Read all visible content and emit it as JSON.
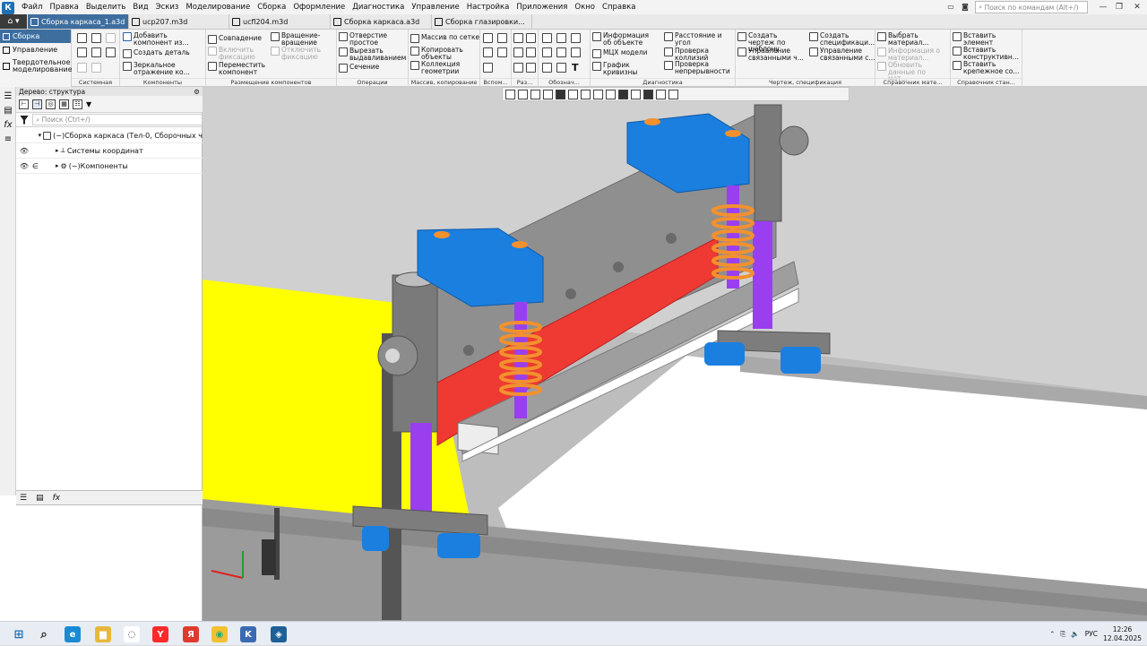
{
  "app": {
    "logo_text": "К"
  },
  "menu": [
    "Файл",
    "Правка",
    "Выделить",
    "Вид",
    "Эскиз",
    "Моделирование",
    "Сборка",
    "Оформление",
    "Диагностика",
    "Управление",
    "Настройка",
    "Приложения",
    "Окно",
    "Справка"
  ],
  "search": {
    "placeholder": "Поиск по командам (Alt+/)"
  },
  "window_controls": {
    "minimize": "—",
    "restore": "❐",
    "close": "✕"
  },
  "tabs": [
    {
      "label": "Сборка каркаса_1.a3d",
      "active": true
    },
    {
      "label": "ucp207.m3d",
      "active": false
    },
    {
      "label": "ucfl204.m3d",
      "active": false
    },
    {
      "label": "Сборка каркаса.a3d",
      "active": false
    },
    {
      "label": "Сборка глазировки...",
      "active": false
    }
  ],
  "leftnav": [
    {
      "label": "Сборка",
      "active": true
    },
    {
      "label": "Управление",
      "active": false
    },
    {
      "label": "Твердотельное моделирование",
      "active": false
    }
  ],
  "ribbon": {
    "groups": [
      {
        "label": "Системная"
      },
      {
        "label": "Компоненты"
      },
      {
        "label": "Размещение компонентов"
      },
      {
        "label": "Операции"
      },
      {
        "label": "Массив, копирование"
      },
      {
        "label": "Вспом..."
      },
      {
        "label": "Раз..."
      },
      {
        "label": "Обознач..."
      },
      {
        "label": "Диагностика"
      },
      {
        "label": "Чертеж, спецификация"
      },
      {
        "label": "Справочник мате..."
      },
      {
        "label": "Справочник стан..."
      }
    ],
    "components": {
      "add": "Добавить компонент из...",
      "create_part": "Создать деталь",
      "mirror": "Зеркальное отражение ко..."
    },
    "placement": {
      "coincidence": "Совпадение",
      "rotation": "Вращение-вращение",
      "enable_fix": "Включить фиксацию",
      "disable_fix": "Отключить фиксацию",
      "move": "Переместить компонент"
    },
    "operations": {
      "hole": "Отверстие простое",
      "cut_extrude": "Вырезать выдавливанием",
      "section": "Сечение"
    },
    "array": {
      "grid": "Массив по сетке",
      "copy": "Копировать объекты",
      "collection": "Коллекция геометрии"
    },
    "diagnostics": {
      "info": "Информация об объекте",
      "mass": "МЦХ модели",
      "curvature": "График кривизны",
      "distance": "Расстояние и угол",
      "collisions": "Проверка коллизий",
      "continuity": "Проверка непрерывности"
    },
    "drawing": {
      "create_drawing": "Создать чертеж по шаблону",
      "linked_drawings": "Управление связанными ч...",
      "create_spec": "Создать спецификаци...",
      "linked_specs": "Управление связанными с..."
    },
    "materials": {
      "choose": "Выбрать материал...",
      "info": "Информация о материал...",
      "update": "Обновить данные по мат..."
    },
    "standard": {
      "insert_element": "Вставить элемент",
      "insert_constructive": "Вставить конструктивн...",
      "insert_fastener": "Вставить крепежное со..."
    }
  },
  "tree": {
    "header": "Дерево: структура",
    "search_placeholder": "Поиск (Ctrl+/)",
    "rows": [
      {
        "label": "(−)Сборка каркаса (Тел-0, Сборочных ч"
      },
      {
        "label": "Системы координат"
      },
      {
        "label": "(−)Компоненты"
      }
    ]
  },
  "bottom_tabs": [
    "tree",
    "properties",
    "fx"
  ],
  "viewport": {
    "colors": {
      "background": "#d3d3d3",
      "frame": "#9d9d9d",
      "blue": "#1b7fe0",
      "orange": "#f2912e",
      "purple": "#9a3ff0",
      "red": "#ee3a33",
      "yellow": "#ffff00",
      "steel": "#8e8e8e"
    }
  },
  "taskbar": {
    "apps": [
      "Windows",
      "Поиск",
      "Edge",
      "Проводник",
      "Яндекс",
      "Я",
      "Chrome",
      "КОМПАС",
      "KOMPAS-3D"
    ],
    "tray": {
      "lang": "РУС",
      "time": "12:26",
      "date": "12.04.2025"
    }
  }
}
